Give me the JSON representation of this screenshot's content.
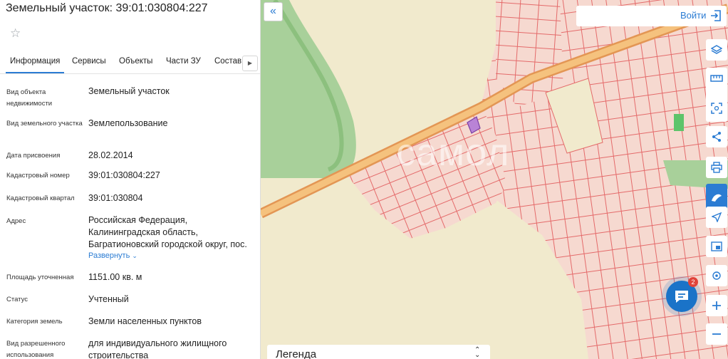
{
  "panel": {
    "title": "Земельный участок: 39:01:030804:227",
    "favorite_icon": "star-outline-icon",
    "tabs": [
      {
        "label": "Информация",
        "active": true
      },
      {
        "label": "Сервисы"
      },
      {
        "label": "Объекты"
      },
      {
        "label": "Части ЗУ"
      },
      {
        "label": "Состав"
      }
    ],
    "tab_scroll_icon": "chevron-right-icon",
    "rows": [
      {
        "label": "Вид объекта недвижимости",
        "value": "Земельный участок"
      },
      {
        "label": "Вид земельного участка",
        "value": "Землепользование"
      },
      {
        "label": "Дата присвоения",
        "value": "28.02.2014"
      },
      {
        "label": "Кадастровый номер",
        "value": "39:01:030804:227"
      },
      {
        "label": "Кадастровый квартал",
        "value": "39:01:030804"
      },
      {
        "label": "Адрес",
        "value": "Российская Федерация, Калининградская область, Багратионовский городской округ, пос."
      },
      {
        "label": "Площадь уточненная",
        "value": "1151.00 кв. м"
      },
      {
        "label": "Статус",
        "value": "Учтенный"
      },
      {
        "label": "Категория земель",
        "value": "Земли населенных пунктов"
      },
      {
        "label": "Вид разрешенного использования",
        "value": "для индивидуального жилищного строительства"
      }
    ],
    "expand_label": "Развернуть"
  },
  "map": {
    "watermark": "самол",
    "collapse_icon": "double-chevron-left-icon",
    "login_label": "Войти",
    "login_icon": "login-icon",
    "tools": [
      "layers-icon",
      "ruler-icon",
      "select-area-icon",
      "share-icon",
      "print-icon",
      "draw-icon",
      "locate-icon",
      "minimap-icon",
      "geolocation-icon",
      "zoom-in-icon",
      "zoom-out-icon"
    ],
    "chat_badge": "2",
    "legend_label": "Легенда",
    "colors": {
      "parcel_border": "#e46a6a",
      "parcel_fill": "#f6d9d0",
      "selected_parcel": "#b983d6",
      "forest": "#a8d09a",
      "road": "#f0b064",
      "accent": "#2b7cd3"
    }
  }
}
